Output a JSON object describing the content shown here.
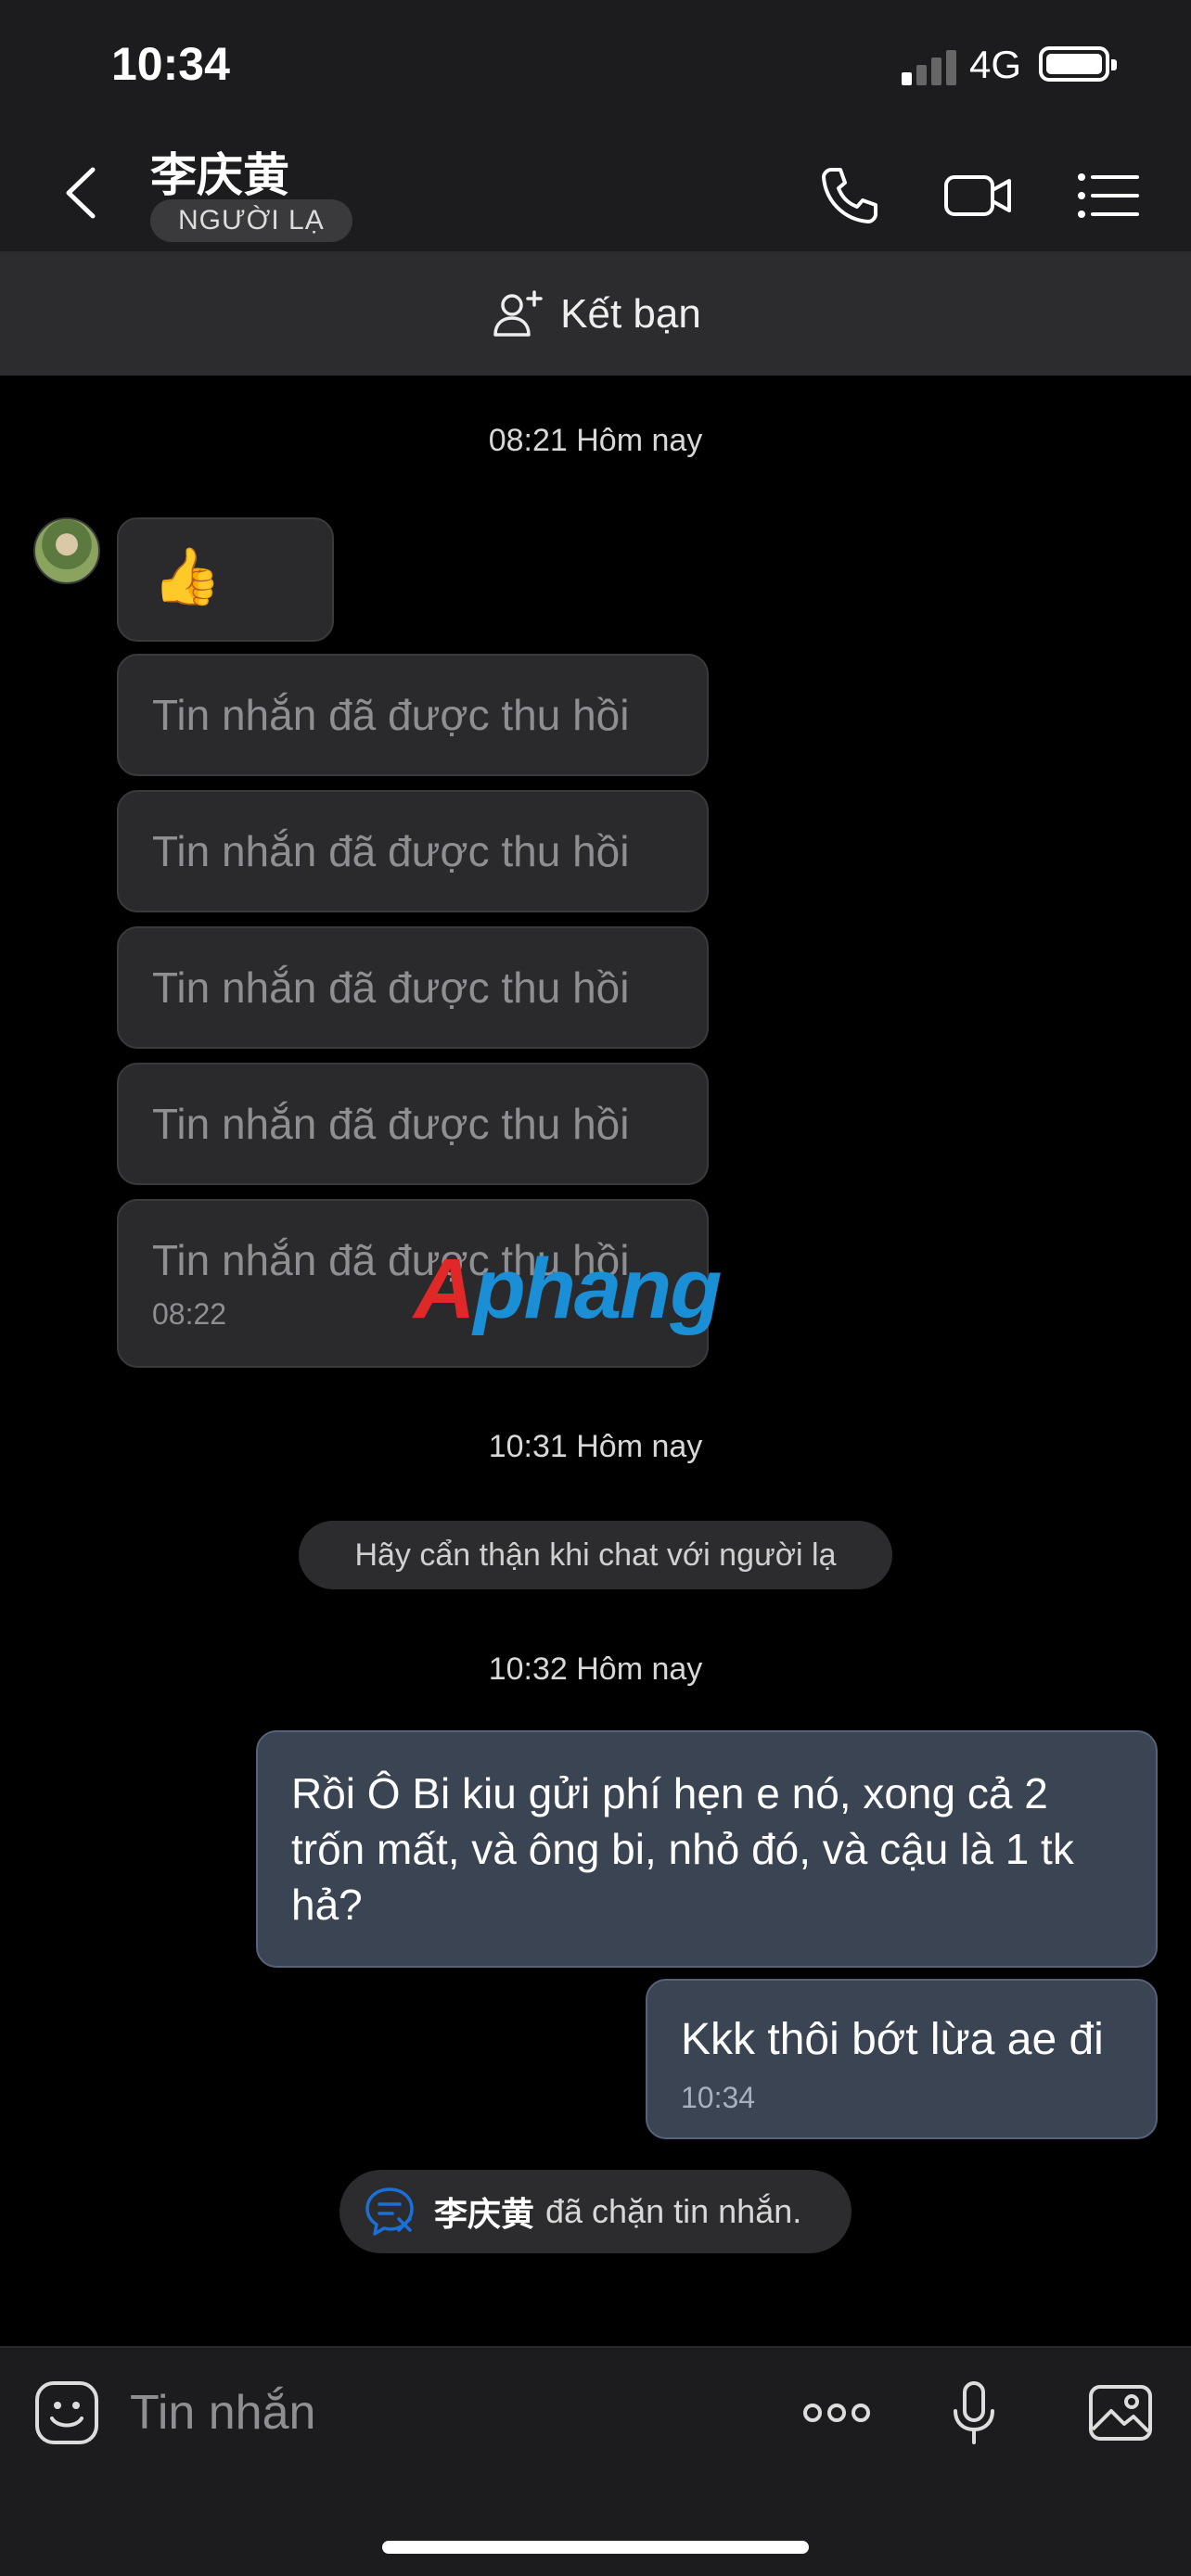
{
  "status_bar": {
    "time": "10:34",
    "network": "4G"
  },
  "header": {
    "contact_name": "李庆黄",
    "badge": "NGƯỜI LẠ"
  },
  "add_friend": {
    "label": "Kết bạn"
  },
  "chat": {
    "timestamp_1": "08:21 Hôm nay",
    "thumb_message": "👍",
    "recalled_messages": [
      "Tin nhắn đã được thu hồi",
      "Tin nhắn đã được thu hồi",
      "Tin nhắn đã được thu hồi",
      "Tin nhắn đã được thu hồi",
      "Tin nhắn đã được thu hồi"
    ],
    "recalled_time": "08:22",
    "timestamp_2": "10:31 Hôm nay",
    "stranger_warning": "Hãy cẩn thận khi chat với người lạ",
    "timestamp_3": "10:32 Hôm nay",
    "outgoing_1": "Rồi  Ô Bi kiu gửi phí hẹn e nó, xong cả 2 trốn mất, và ông bi, nhỏ đó, và cậu là 1 tk hả?",
    "outgoing_2": "Kkk thôi bớt lừa ae đi",
    "outgoing_2_time": "10:34",
    "blocked_name": "李庆黄",
    "blocked_text": "đã chặn tin nhắn."
  },
  "watermark": {
    "first": "A",
    "rest": "phang"
  },
  "input": {
    "placeholder": "Tin nhắn"
  },
  "colors": {
    "outgoing_bubble": "#3a4453",
    "incoming_bubble": "#2a2a2c",
    "accent_blue": "#1b8fd6"
  },
  "icons": [
    "back-chevron-icon",
    "phone-icon",
    "video-icon",
    "menu-list-icon",
    "add-user-icon",
    "sticker-icon",
    "more-dots-icon",
    "microphone-icon",
    "image-icon",
    "blocked-chat-icon"
  ]
}
